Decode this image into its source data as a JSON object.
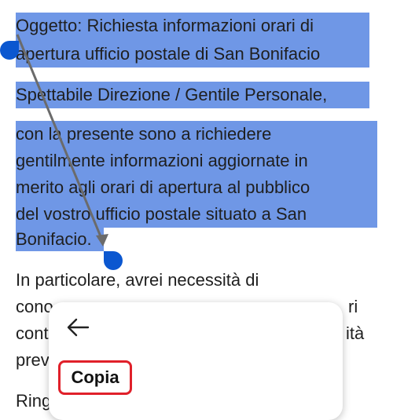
{
  "document": {
    "lines": [
      "Oggetto: Richiesta informazioni orari di",
      "apertura ufficio postale di San Bonifacio",
      "Spettabile Direzione / Gentile Personale,",
      "con la presente sono a richiedere",
      "gentilmente informazioni aggiornate in",
      "merito agli orari di apertura al pubblico",
      "del vostro ufficio postale situato a San",
      "Bonifacio.",
      "In particolare, avrei necessità di",
      "cono",
      "cont",
      "prev",
      "Ring"
    ],
    "partial_right": [
      "ri",
      "ità"
    ]
  },
  "context_menu": {
    "back_icon": "arrow-left-icon",
    "copy_label": "Copia"
  },
  "colors": {
    "selection": "#6f97e6",
    "handle": "#0b57d0",
    "highlight": "#e0202a"
  }
}
